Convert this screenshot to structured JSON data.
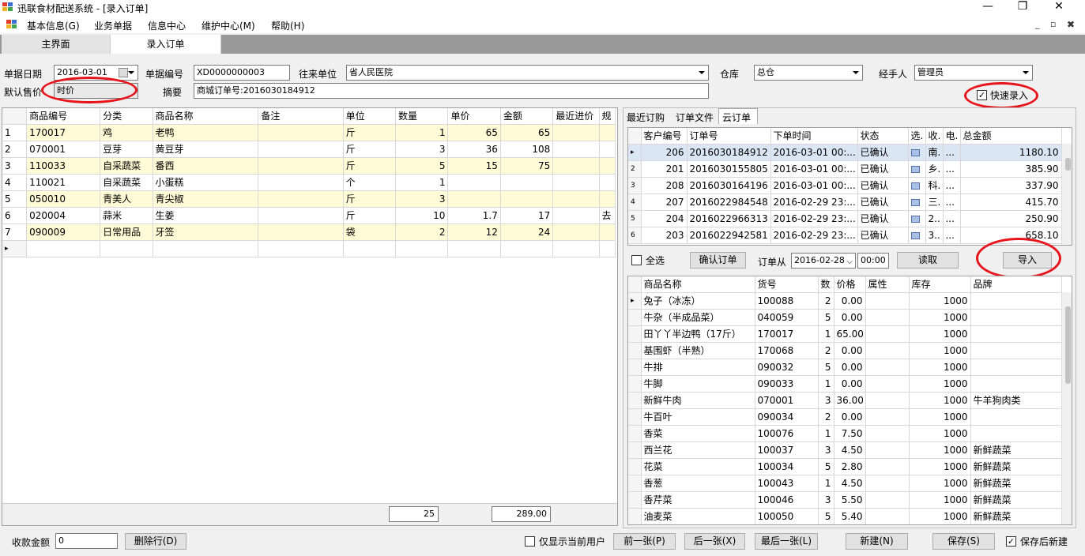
{
  "window": {
    "title": "迅联食材配送系统 - [录入订单]",
    "min": "—",
    "max": "❐",
    "close": "✕"
  },
  "menu": [
    "基本信息(G)",
    "业务单据",
    "信息中心",
    "维护中心(M)",
    "帮助(H)"
  ],
  "mdi": {
    "min": "_",
    "restore": "▫",
    "close": "✖"
  },
  "tabs": [
    "主界面",
    "录入订单"
  ],
  "form": {
    "date_label": "单据日期",
    "date_value": "2016-03-01",
    "no_label": "单据编号",
    "no_value": "XD0000000003",
    "party_label": "往来单位",
    "party_value": "省人民医院",
    "warehouse_label": "仓库",
    "warehouse_value": "总仓",
    "handler_label": "经手人",
    "handler_value": "管理员",
    "price_label": "默认售价",
    "price_value": "时价",
    "memo_label": "摘要",
    "memo_value": "商城订单号:2016030184912",
    "quick_label": "快速录入"
  },
  "main_grid": {
    "headers": [
      "商品编号",
      "分类",
      "商品名称",
      "备注",
      "单位",
      "数量",
      "单价",
      "金额",
      "最近进价",
      "规"
    ],
    "rows": [
      [
        "1",
        "170017",
        "鸡",
        "老鸭",
        "",
        "斤",
        "1",
        "65",
        "65",
        "",
        ""
      ],
      [
        "2",
        "070001",
        "豆芽",
        "黄豆芽",
        "",
        "斤",
        "3",
        "36",
        "108",
        "",
        ""
      ],
      [
        "3",
        "110033",
        "自采蔬菜",
        "番西",
        "",
        "斤",
        "5",
        "15",
        "75",
        "",
        ""
      ],
      [
        "4",
        "110021",
        "自采蔬菜",
        "小蛋糕",
        "",
        "个",
        "1",
        "",
        "",
        "",
        ""
      ],
      [
        "5",
        "050010",
        "青美人",
        "青尖椒",
        "",
        "斤",
        "3",
        "",
        "",
        "",
        ""
      ],
      [
        "6",
        "020004",
        "蒜米",
        "生姜",
        "",
        "斤",
        "10",
        "1.7",
        "17",
        "",
        "去"
      ],
      [
        "7",
        "090009",
        "日常用品",
        "牙签",
        "",
        "袋",
        "2",
        "12",
        "24",
        "",
        ""
      ]
    ],
    "new_row_marker": "▸",
    "total_qty": "25",
    "total_amount": "289.00"
  },
  "right_tabs": [
    "最近订购",
    "订单文件",
    "云订单"
  ],
  "cloud_grid": {
    "headers": [
      "客户编号",
      "订单号",
      "下单时间",
      "状态",
      "选.",
      "收.",
      "电.",
      "总金额"
    ],
    "row_marks": [
      "▸",
      "2",
      "3",
      "4",
      "5",
      "6"
    ],
    "rows": [
      [
        "206",
        "2016030184912",
        "2016-03-01 00:...",
        "已确认",
        "南.",
        "...",
        "1180.10"
      ],
      [
        "201",
        "2016030155805",
        "2016-03-01 00:...",
        "已确认",
        "乡.",
        "...",
        "385.90"
      ],
      [
        "208",
        "2016030164196",
        "2016-03-01 00:...",
        "已确认",
        "科.",
        "...",
        "337.90"
      ],
      [
        "207",
        "2016022984548",
        "2016-02-29 23:...",
        "已确认",
        "三.",
        "...",
        "415.70"
      ],
      [
        "204",
        "2016022966313",
        "2016-02-29 23:...",
        "已确认",
        "2..",
        "...",
        "250.90"
      ],
      [
        "203",
        "2016022942581",
        "2016-02-29 23:...",
        "已确认",
        "3..",
        "...",
        "658.10"
      ]
    ]
  },
  "cloud_ctrl": {
    "select_all": "全选",
    "confirm": "确认订单",
    "from_label": "订单从",
    "from_date": "2016-02-28",
    "from_time": "00:00",
    "read": "读取",
    "import": "导入"
  },
  "goods_grid": {
    "headers": [
      "商品名称",
      "货号",
      "数",
      "价格",
      "属性",
      "库存",
      "品牌"
    ],
    "rows": [
      [
        "兔子（冰冻）",
        "100088",
        "2",
        "0.00",
        "",
        "1000",
        ""
      ],
      [
        "牛杂（半成品菜）",
        "040059",
        "5",
        "0.00",
        "",
        "1000",
        ""
      ],
      [
        "田丫丫半边鸭（17斤）",
        "170017",
        "1",
        "65.00",
        "",
        "1000",
        ""
      ],
      [
        "基围虾（半熟）",
        "170068",
        "2",
        "0.00",
        "",
        "1000",
        ""
      ],
      [
        "牛排",
        "090032",
        "5",
        "0.00",
        "",
        "1000",
        ""
      ],
      [
        "牛脚",
        "090033",
        "1",
        "0.00",
        "",
        "1000",
        ""
      ],
      [
        "新鲜牛肉",
        "070001",
        "3",
        "36.00",
        "",
        "1000",
        "牛羊狗肉类"
      ],
      [
        "牛百叶",
        "090034",
        "2",
        "0.00",
        "",
        "1000",
        ""
      ],
      [
        "香菜",
        "100076",
        "1",
        "7.50",
        "",
        "1000",
        ""
      ],
      [
        "西兰花",
        "100037",
        "3",
        "4.50",
        "",
        "1000",
        "新鲜蔬菜"
      ],
      [
        "花菜",
        "100034",
        "5",
        "2.80",
        "",
        "1000",
        "新鲜蔬菜"
      ],
      [
        "香葱",
        "100043",
        "1",
        "4.50",
        "",
        "1000",
        "新鲜蔬菜"
      ],
      [
        "香芹菜",
        "100046",
        "3",
        "5.50",
        "",
        "1000",
        "新鲜蔬菜"
      ],
      [
        "油麦菜",
        "100050",
        "5",
        "5.40",
        "",
        "1000",
        "新鲜蔬菜"
      ]
    ]
  },
  "bottom": {
    "receive_label": "收款金额",
    "receive_value": "0",
    "delete_row": "删除行(D)",
    "only_current": "仅显示当前用户",
    "prev": "前一张(P)",
    "next": "后一张(X)",
    "last": "最后一张(L)",
    "new": "新建(N)",
    "save": "保存(S)",
    "save_new": "保存后新建"
  },
  "colors": {
    "ring": "#e8141c",
    "row_yellow": "#fffbd6",
    "tab_bg": "#999999"
  }
}
